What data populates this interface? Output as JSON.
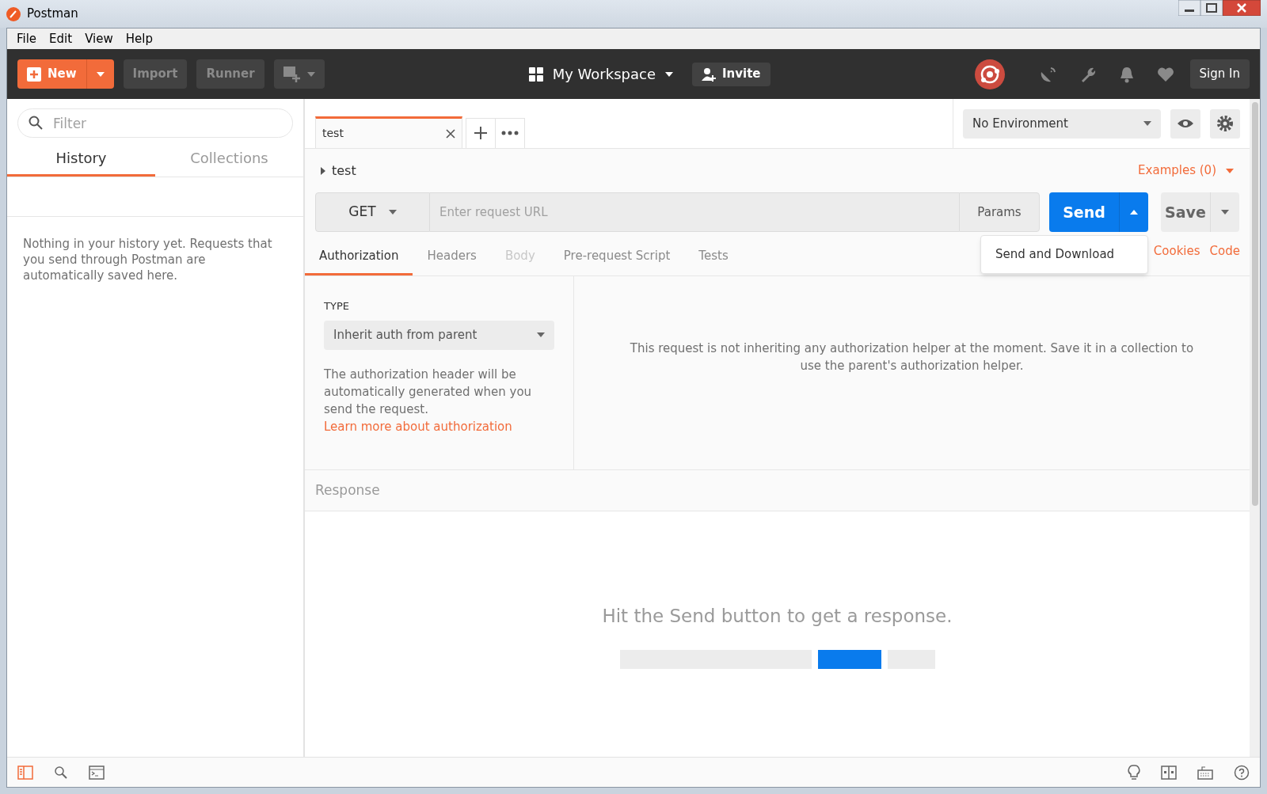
{
  "window": {
    "title": "Postman"
  },
  "menu": [
    "File",
    "Edit",
    "View",
    "Help"
  ],
  "toolbar": {
    "new_label": "New",
    "import_label": "Import",
    "runner_label": "Runner",
    "workspace": "My Workspace",
    "invite": "Invite",
    "sign_in": "Sign In"
  },
  "sidebar": {
    "filter_placeholder": "Filter",
    "tabs": [
      {
        "label": "History",
        "selected": true
      },
      {
        "label": "Collections",
        "selected": false
      }
    ],
    "empty_message": "Nothing in your history yet. Requests that you send through Postman are automatically saved here."
  },
  "request_tabs": [
    {
      "label": "test",
      "selected": true
    }
  ],
  "environment": "No Environment",
  "request": {
    "name": "test",
    "examples": "Examples (0)",
    "method": "GET",
    "url_placeholder": "Enter request URL",
    "params": "Params",
    "send": "Send",
    "save": "Save",
    "send_menu": [
      "Send and Download"
    ]
  },
  "subtabs": [
    {
      "label": "Authorization",
      "selected": true,
      "disabled": false
    },
    {
      "label": "Headers",
      "selected": false,
      "disabled": false
    },
    {
      "label": "Body",
      "selected": false,
      "disabled": true
    },
    {
      "label": "Pre-request Script",
      "selected": false,
      "disabled": false
    },
    {
      "label": "Tests",
      "selected": false,
      "disabled": false
    }
  ],
  "links": [
    "Cookies",
    "Code"
  ],
  "auth": {
    "type_label": "TYPE",
    "type_value": "Inherit auth from parent",
    "description": "The authorization header will be automatically generated when you send the request.",
    "link": "Learn more about authorization",
    "message": "This request is not inheriting any authorization helper at the moment. Save it in a collection to use the parent's authorization helper."
  },
  "response": {
    "title": "Response",
    "hint": "Hit the Send button to get a response."
  }
}
